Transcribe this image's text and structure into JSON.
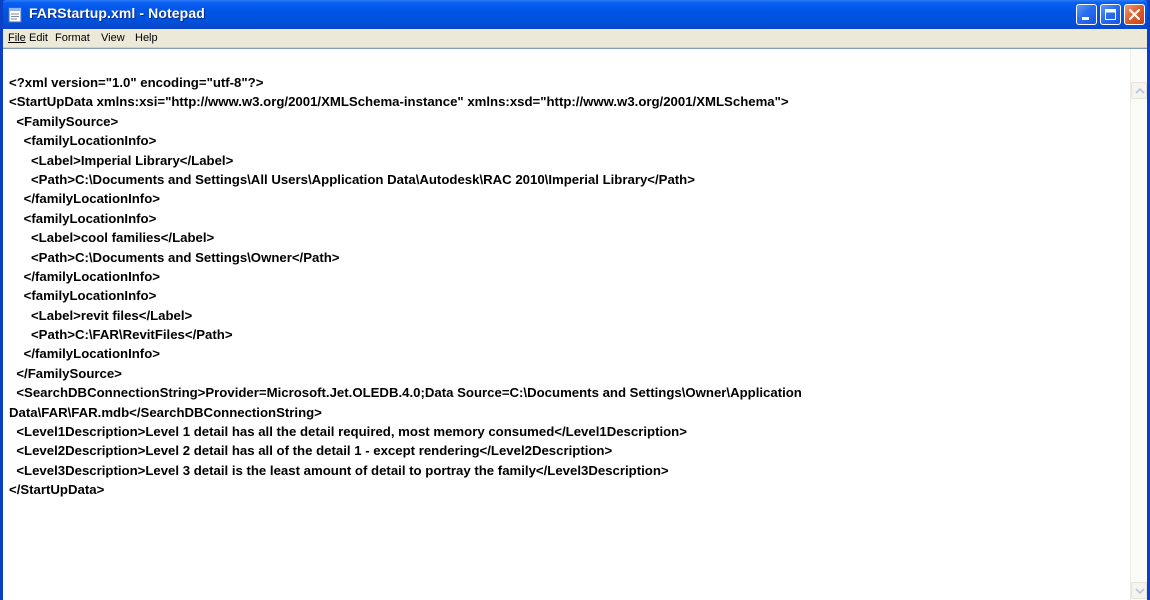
{
  "window": {
    "title": "FARStartup.xml - Notepad",
    "controls": [
      "minimize",
      "maximize",
      "close"
    ],
    "colors": {
      "titlebar": "#0054e3",
      "close_button": "#e0602e",
      "menubar": "#ece9d8"
    }
  },
  "menu": {
    "items": [
      {
        "label": "File"
      },
      {
        "label": "Edit"
      },
      {
        "label": "Format"
      },
      {
        "label": "View"
      },
      {
        "label": "Help"
      }
    ]
  },
  "editor": {
    "lines": [
      "<?xml version=\"1.0\" encoding=\"utf-8\"?>",
      "<StartUpData xmlns:xsi=\"http://www.w3.org/2001/XMLSchema-instance\" xmlns:xsd=\"http://www.w3.org/2001/XMLSchema\">",
      "  <FamilySource>",
      "    <familyLocationInfo>",
      "      <Label>Imperial Library</Label>",
      "      <Path>C:\\Documents and Settings\\All Users\\Application Data\\Autodesk\\RAC 2010\\Imperial Library</Path>",
      "    </familyLocationInfo>",
      "    <familyLocationInfo>",
      "      <Label>cool families</Label>",
      "      <Path>C:\\Documents and Settings\\Owner</Path>",
      "    </familyLocationInfo>",
      "    <familyLocationInfo>",
      "      <Label>revit files</Label>",
      "      <Path>C:\\FAR\\RevitFiles</Path>",
      "    </familyLocationInfo>",
      "  </FamilySource>",
      "  <SearchDBConnectionString>Provider=Microsoft.Jet.OLEDB.4.0;Data Source=C:\\Documents and Settings\\Owner\\Application",
      "Data\\FAR\\FAR.mdb</SearchDBConnectionString>",
      "  <Level1Description>Level 1 detail has all the detail required, most memory consumed</Level1Description>",
      "  <Level2Description>Level 2 detail has all of the detail 1 - except rendering</Level2Description>",
      "  <Level3Description>Level 3 detail is the least amount of detail to portray the family</Level3Description>",
      "</StartUpData>"
    ]
  }
}
